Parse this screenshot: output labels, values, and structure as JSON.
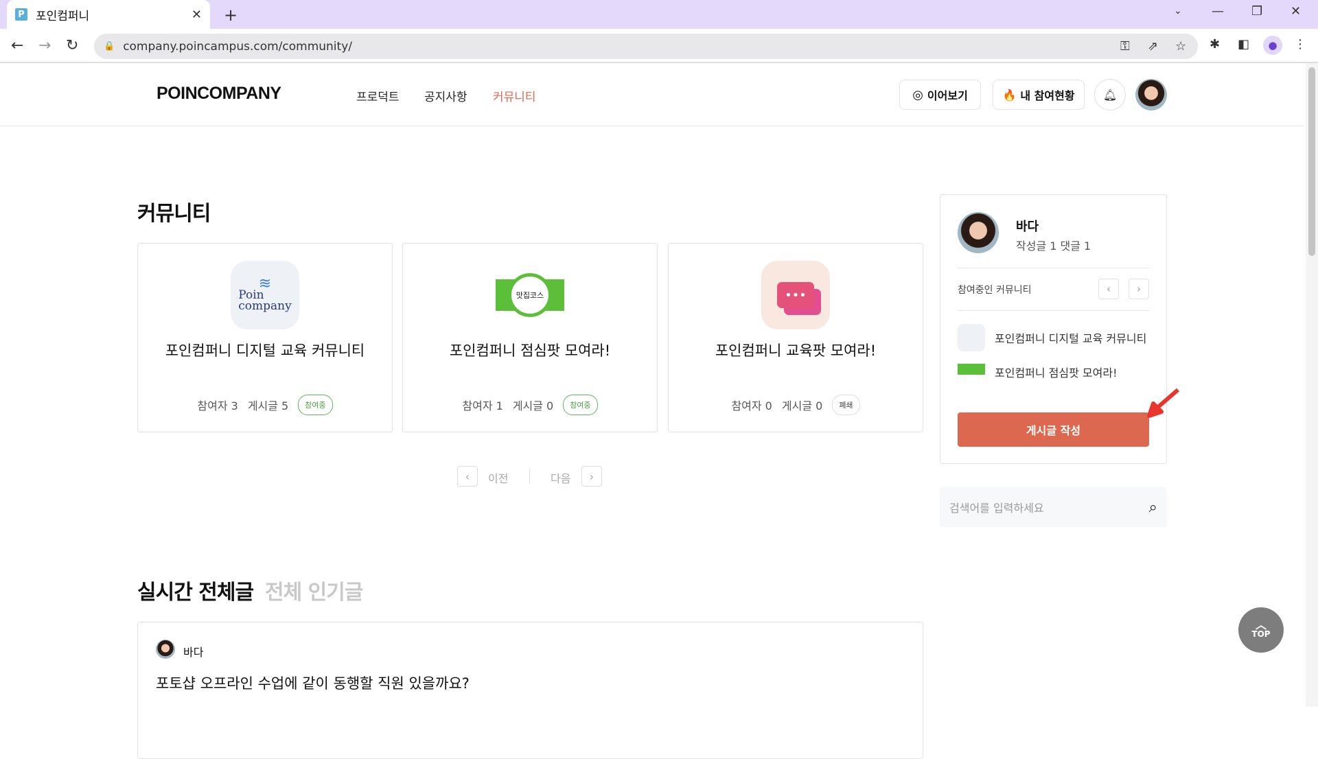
{
  "browser": {
    "tab_title": "포인컴퍼니",
    "favicon_letter": "P",
    "url": "company.poincampus.com/community/",
    "accent": "#e5d9fb"
  },
  "header": {
    "logo": "POINCOMPANY",
    "nav": [
      {
        "label": "프로덕트"
      },
      {
        "label": "공지사항"
      },
      {
        "label": "커뮤니티",
        "active": true,
        "color": "#e0684f"
      }
    ],
    "continue_label": "이어보기",
    "my_status_label": "내 참여현황"
  },
  "community": {
    "title": "커뮤니티",
    "cards": [
      {
        "title": "포인컴퍼니 디지털 교육 커뮤니티",
        "participants": "참여자 3",
        "posts": "게시글 5",
        "badge": "참여중",
        "logo_text": "Poin company"
      },
      {
        "title": "포인컴퍼니 점심팟 모여라!",
        "participants": "참여자 1",
        "posts": "게시글 0",
        "badge": "참여중",
        "logo_text": "맛집코스"
      },
      {
        "title": "포인컴퍼니 교육팟 모여라!",
        "participants": "참여자 0",
        "posts": "게시글 0",
        "badge": "폐쇄"
      }
    ],
    "prev_label": "이전",
    "next_label": "다음"
  },
  "sidebar": {
    "name": "바다",
    "stats": "작성글 1 댓글 1",
    "joined_label": "참여중인 커뮤니티",
    "joined": [
      {
        "label": "포인컴퍼니 디지털 교육 커뮤니티"
      },
      {
        "label": "포인컴퍼니 점심팟 모여라!"
      }
    ],
    "write_label": "게시글 작성",
    "button_color": "#dd6850",
    "search_placeholder": "검색어를 입력하세요"
  },
  "feed": {
    "tabs": [
      {
        "label": "실시간 전체글",
        "active": true
      },
      {
        "label": "전체 인기글",
        "active": false
      }
    ],
    "posts": [
      {
        "author": "바다",
        "title": "포토샵 오프라인 수업에 같이 동행할 직원 있을까요?"
      }
    ]
  },
  "top_label": "TOP"
}
